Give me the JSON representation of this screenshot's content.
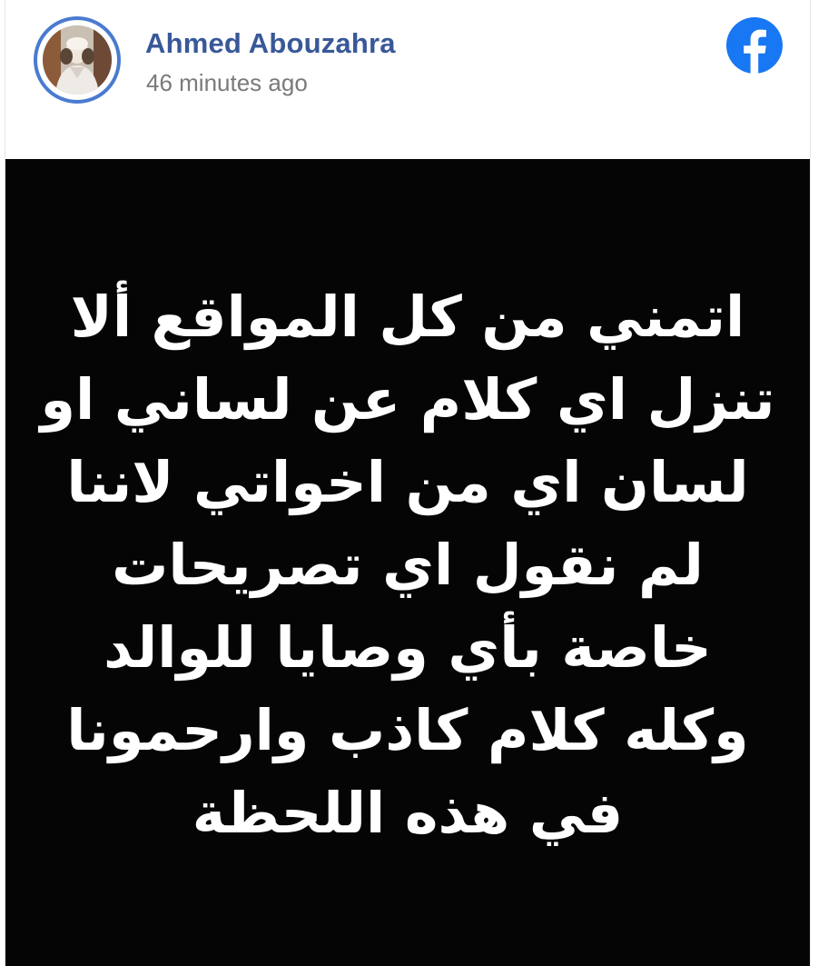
{
  "post": {
    "author_name": "Ahmed Abouzahra",
    "timestamp": "46 minutes ago",
    "platform_icon": "facebook-icon",
    "avatar_icon": "profile-photo",
    "image_text": "اتمني من كل المواقع ألا\nتنزل اي كلام عن لساني او\nلسان اي من اخواتي لاننا\nلم نقول اي تصريحات\nخاصة بأي وصايا للوالد\nوكله كلام كاذب وارحمونا\nفي هذه اللحظة"
  },
  "colors": {
    "name": "#385898",
    "timestamp": "#7a7a7a",
    "avatar_ring": "#4a7bd0",
    "facebook_blue": "#1877f2",
    "image_background": "#050505",
    "image_text": "#ffffff"
  }
}
